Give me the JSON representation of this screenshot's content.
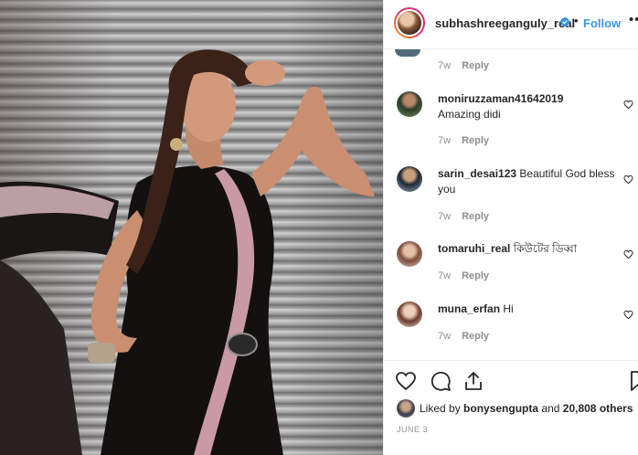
{
  "post": {
    "username": "subhashreeganguly_real",
    "separator": "•",
    "follow_label": "Follow",
    "more_label": "•••"
  },
  "comments": [
    {
      "user": "",
      "text": "",
      "age": "7w",
      "reply_label": "Reply"
    },
    {
      "user": "moniruzzaman41642019",
      "text": "Amazing didi",
      "age": "7w",
      "reply_label": "Reply"
    },
    {
      "user": "sarin_desai123",
      "text": "Beautiful God bless you",
      "age": "7w",
      "reply_label": "Reply"
    },
    {
      "user": "tomaruhi_real",
      "text": "কিউটের ডিব্বা",
      "age": "7w",
      "reply_label": "Reply"
    },
    {
      "user": "muna_erfan",
      "text": "Hi",
      "age": "7w",
      "reply_label": "Reply"
    }
  ],
  "likes": {
    "prefix": "Liked by",
    "first_liker": "bonysengupta",
    "conjunction": "and",
    "others": "20,808 others"
  },
  "date": "JUNE 3",
  "icons": [
    "verified-badge-icon",
    "heart-icon",
    "comment-icon",
    "share-icon",
    "bookmark-icon",
    "more-icon"
  ],
  "colors": {
    "accent": "#3897f0",
    "muted": "#8e8e8e",
    "text": "#262626"
  }
}
